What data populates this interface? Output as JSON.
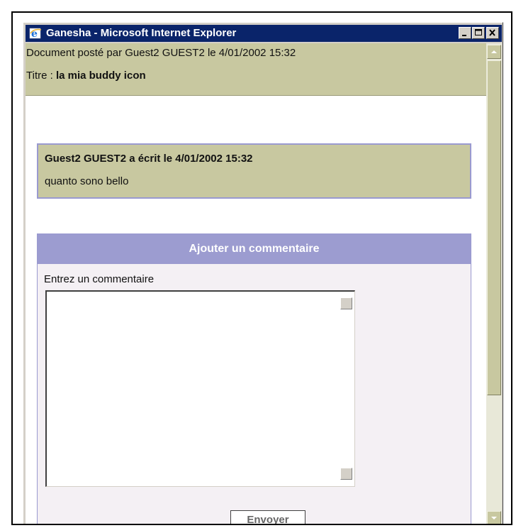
{
  "window": {
    "title": "Ganesha - Microsoft Internet Explorer",
    "app_icon": "internet-explorer-icon",
    "controls": [
      "minimize-icon",
      "maximize-icon",
      "close-icon"
    ]
  },
  "document": {
    "posted_line": "Document posté par Guest2 GUEST2 le 4/01/2002 15:32",
    "title_prefix": "Titre : ",
    "title_value": "la mia buddy icon"
  },
  "message": {
    "author_line": "Guest2 GUEST2 a écrit le 4/01/2002 15:32",
    "body": "quanto sono bello"
  },
  "comment_form": {
    "header": "Ajouter un commentaire",
    "label": "Entrez un commentaire",
    "value": "",
    "submit_label": "Envoyer"
  },
  "colors": {
    "titlebar": "#0a246a",
    "header_band": "#c8c8a0",
    "panel_header": "#9c9cd0",
    "panel_border": "#9a9ad0"
  }
}
